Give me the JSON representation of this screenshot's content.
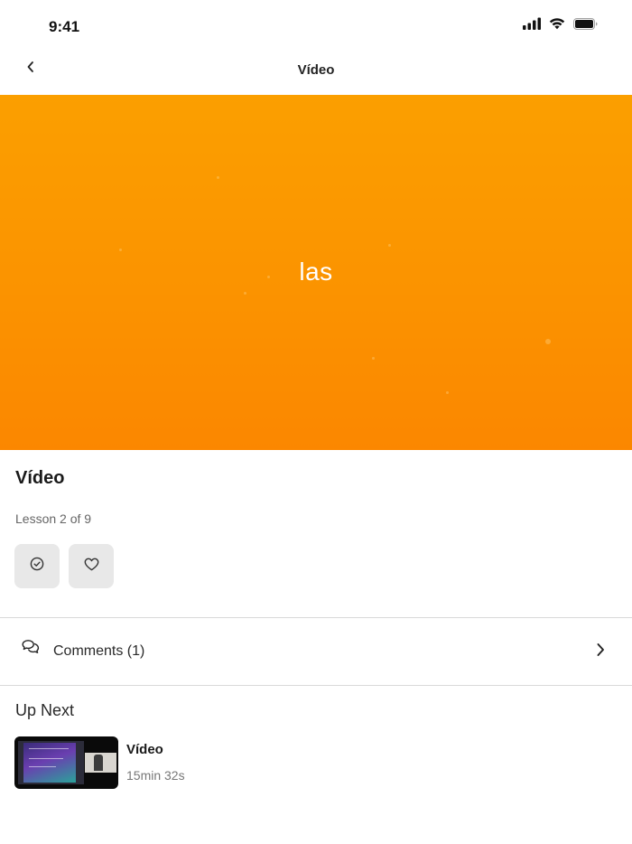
{
  "status_bar": {
    "time": "9:41",
    "icons": [
      "signal-icon",
      "wifi-icon",
      "battery-icon"
    ]
  },
  "nav": {
    "title": "Vídeo",
    "back_icon": "chevron-left-icon"
  },
  "hero": {
    "overlay_text": "las",
    "background_color": "#fb9300"
  },
  "lesson": {
    "title": "Vídeo",
    "progress_text": "Lesson 2 of 9",
    "actions": [
      {
        "name": "mark-complete",
        "icon": "check-circle-icon"
      },
      {
        "name": "like",
        "icon": "heart-icon"
      }
    ]
  },
  "comments": {
    "label": "Comments (1)",
    "icon": "chat-bubbles-icon",
    "chevron_icon": "chevron-right-icon"
  },
  "up_next": {
    "heading": "Up Next",
    "items": [
      {
        "title": "Vídeo",
        "duration": "15min 32s"
      }
    ]
  },
  "colors": {
    "accent": "#fb9300",
    "button_bg": "#e8e8e8",
    "divider": "#d9d9d9"
  }
}
